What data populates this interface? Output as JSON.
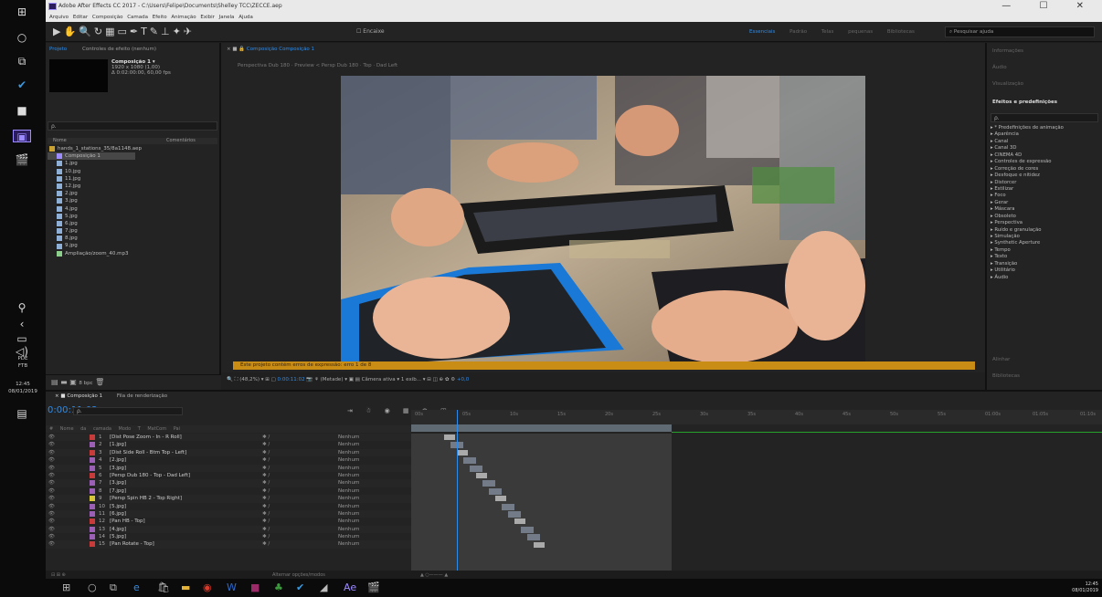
{
  "window": {
    "title": "Adobe After Effects CC 2017 - C:\\Users\\Felipe\\Documents\\Shelley TCC\\ZECCE.aep",
    "controls": "— ☐ ✕"
  },
  "menu": {
    "items": [
      "Arquivo",
      "Editar",
      "Composição",
      "Camada",
      "Efeito",
      "Animação",
      "Exibir",
      "Janela",
      "Ajuda"
    ]
  },
  "toolbar": {
    "snap_label": "Encaixe",
    "workspaces": [
      "Essenciais",
      "Padrão",
      "Telas pequenas",
      "Bibliotecas"
    ],
    "active_workspace": "Essenciais",
    "search_placeholder": "Pesquisar ajuda"
  },
  "taskbar_left": {
    "text1": "PDE",
    "text2": "FTB",
    "time": "12:45",
    "date": "08/01/2019"
  },
  "project": {
    "tab_project": "Projeto",
    "tab_effects": "Controles de efeito (nenhum)",
    "comp_name": "Composição 1 ▾",
    "comp_size": "1920 x 1080 (1,00)",
    "comp_duration": "Δ 0:02:00:00, 60,00 fps",
    "search_value": "ρ.",
    "col_name": "Nome",
    "col_comments": "Comentários",
    "items": [
      {
        "name": "hands_1_stations_35/8a1148.aep",
        "type": "folder"
      },
      {
        "name": "Composição 1",
        "type": "comp"
      },
      {
        "name": "1.jpg",
        "type": "jpg"
      },
      {
        "name": "10.jpg",
        "type": "jpg"
      },
      {
        "name": "11.jpg",
        "type": "jpg"
      },
      {
        "name": "12.jpg",
        "type": "jpg"
      },
      {
        "name": "2.jpg",
        "type": "jpg"
      },
      {
        "name": "3.jpg",
        "type": "jpg"
      },
      {
        "name": "4.jpg",
        "type": "jpg"
      },
      {
        "name": "5.jpg",
        "type": "jpg"
      },
      {
        "name": "6.jpg",
        "type": "jpg"
      },
      {
        "name": "7.jpg",
        "type": "jpg"
      },
      {
        "name": "8.jpg",
        "type": "jpg"
      },
      {
        "name": "9.jpg",
        "type": "jpg"
      },
      {
        "name": "Ampliação/zoom_40.mp3",
        "type": "audio"
      }
    ],
    "bpc": "8 bpc"
  },
  "composition": {
    "tab": "Composição Composição 1",
    "view_path": "Perspectiva Dub 180 · Preview  <  Persp Dub 180 · Top · Dad Left",
    "warning": "Este projeto contém erros de expressão: erro 1 de 8",
    "zoom": "(48,2%)",
    "timecode": "0:00:11:02",
    "resolution": "(Metade)",
    "camera": "Câmera ativa",
    "view": "1 exib...",
    "exposure": "+0,0"
  },
  "right_panel": {
    "headers": [
      "Informações",
      "Áudio",
      "Visualização"
    ],
    "effects_title": "Efeitos e predefinições",
    "search_value": "ρ.",
    "items": [
      "* Predefinições de animação",
      "Aparência",
      "Canal",
      "Canal 3D",
      "CINEMA 4D",
      "Controles de expressão",
      "Correção de cores",
      "Desfoque e nitidez",
      "Distorcer",
      "Estilizar",
      "Foco",
      "Gerar",
      "Máscara",
      "Obsoleto",
      "Perspectiva",
      "Ruído e granulação",
      "Simulação",
      "Synthetic Aperture",
      "Tempo",
      "Texto",
      "Transição",
      "Utilitário",
      "Áudio"
    ],
    "bottom_headers": [
      "Alinhar",
      "Bibliotecas"
    ]
  },
  "timeline": {
    "tab_comp": "Composição 1",
    "tab_render": "Fila de renderização",
    "timecode": "0:00:11:02",
    "search_value": "ρ.",
    "col_header": "# Nome da camada  Modo  T  MatCom  Pai",
    "ruler": [
      "00s",
      "05s",
      "10s",
      "15s",
      "20s",
      "25s",
      "30s",
      "35s",
      "40s",
      "45s",
      "50s",
      "55s",
      "01:00s",
      "01:05s",
      "01:10s"
    ],
    "layers": [
      {
        "num": "1",
        "name": "[Dist Pose Zoom - In - R Roll]",
        "color": "#c73b3b",
        "mode": "Nenhum"
      },
      {
        "num": "2",
        "name": "[1.jpg]",
        "color": "#9b5fb5",
        "mode": "Nenhum"
      },
      {
        "num": "3",
        "name": "[Dist Side Roll - Btm Top - Left]",
        "color": "#c73b3b",
        "mode": "Nenhum"
      },
      {
        "num": "4",
        "name": "[2.jpg]",
        "color": "#9b5fb5",
        "mode": "Nenhum"
      },
      {
        "num": "5",
        "name": "[3.jpg]",
        "color": "#9b5fb5",
        "mode": "Nenhum"
      },
      {
        "num": "6",
        "name": "[Persp Dub 180 - Top - Dad Left]",
        "color": "#c73b3b",
        "mode": "Nenhum"
      },
      {
        "num": "7",
        "name": "[3.jpg]",
        "color": "#9b5fb5",
        "mode": "Nenhum"
      },
      {
        "num": "8",
        "name": "[7.jpg]",
        "color": "#9b5fb5",
        "mode": "Nenhum"
      },
      {
        "num": "9",
        "name": "[Persp Spin HB 2 - Top Right]",
        "color": "#d6c63a",
        "mode": "Nenhum"
      },
      {
        "num": "10",
        "name": "[5.jpg]",
        "color": "#9b5fb5",
        "mode": "Nenhum"
      },
      {
        "num": "11",
        "name": "[6.jpg]",
        "color": "#9b5fb5",
        "mode": "Nenhum"
      },
      {
        "num": "12",
        "name": "[Pan HB - Top]",
        "color": "#c73b3b",
        "mode": "Nenhum"
      },
      {
        "num": "13",
        "name": "[4.jpg]",
        "color": "#9b5fb5",
        "mode": "Nenhum"
      },
      {
        "num": "14",
        "name": "[5.jpg]",
        "color": "#9b5fb5",
        "mode": "Nenhum"
      },
      {
        "num": "15",
        "name": "[Pan Rotate - Top]",
        "color": "#c73b3b",
        "mode": "Nenhum"
      }
    ],
    "toggle_label": "Alternar opções/modos"
  },
  "taskbar_bottom": {
    "time": "12:45",
    "date": "08/01/2019"
  },
  "colors": {
    "accent": "#2d8ceb",
    "warning": "#c98d16",
    "workarea": "#5f6a73"
  }
}
